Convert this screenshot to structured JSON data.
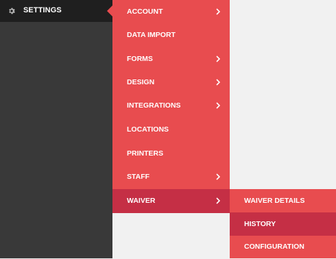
{
  "sidebar": {
    "icon": "gear-icon",
    "label": "SETTINGS"
  },
  "menu": {
    "items": [
      {
        "label": "ACCOUNT",
        "has_submenu": true
      },
      {
        "label": "DATA IMPORT",
        "has_submenu": false
      },
      {
        "label": "FORMS",
        "has_submenu": true
      },
      {
        "label": "DESIGN",
        "has_submenu": true
      },
      {
        "label": "INTEGRATIONS",
        "has_submenu": true
      },
      {
        "label": "LOCATIONS",
        "has_submenu": false
      },
      {
        "label": "PRINTERS",
        "has_submenu": false
      },
      {
        "label": "STAFF",
        "has_submenu": true
      },
      {
        "label": "WAIVER",
        "has_submenu": true,
        "active": true
      }
    ]
  },
  "submenu": {
    "items": [
      {
        "label": "WAIVER DETAILS"
      },
      {
        "label": "HISTORY",
        "active": true
      },
      {
        "label": "CONFIGURATION"
      }
    ]
  },
  "colors": {
    "menu_bg": "#e84c4f",
    "menu_active": "#c52f45",
    "sidebar_bg": "#393939",
    "sidebar_header_bg": "#1f1f1f",
    "content_bg": "#f1f1f1"
  }
}
